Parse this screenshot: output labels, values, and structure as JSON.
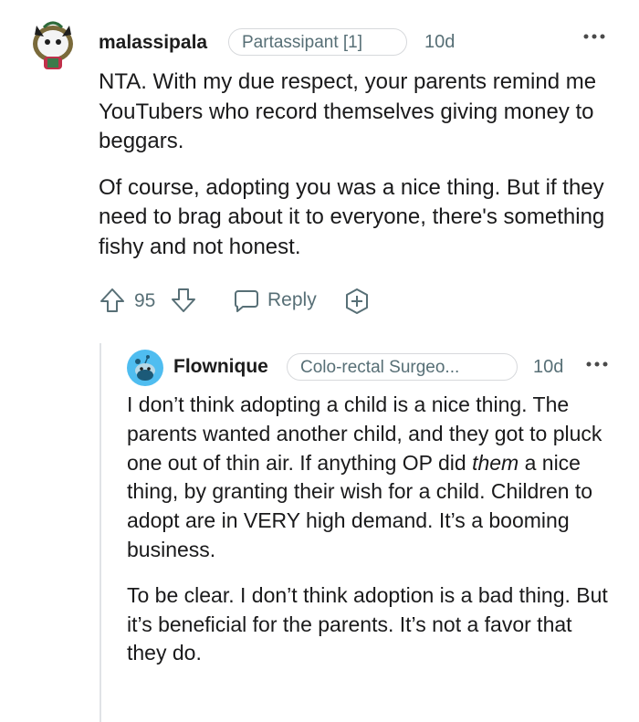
{
  "comment": {
    "username": "malassipala",
    "flair": "Partassipant [1]",
    "time": "10d",
    "paragraphs": [
      "NTA. With my due respect, your parents remind me YouTubers who record themselves giving money to beggars.",
      "Of course, adopting you was a nice thing. But if they need to brag about it to everyone, there's something fishy and not honest."
    ],
    "votes": "95",
    "reply_label": "Reply"
  },
  "reply": {
    "username": "Flownique",
    "flair": "Colo-rectal Surgeo...",
    "time": "10d",
    "p1_before": "I don’t think adopting a child is a nice thing. The parents wanted another child, and they got to pluck one out of thin air. If anything OP did ",
    "p1_emphasis": "them",
    "p1_after": " a nice thing, by granting their wish for a child. Children to adopt are in VERY high demand. It’s a booming business.",
    "p2": "To be clear. I don’t think adoption is a bad thing. But it’s beneficial for the parents. It’s not a favor that they do."
  },
  "icons": {
    "upvote": "arrow-up-icon",
    "downvote": "arrow-down-icon",
    "reply": "speech-bubble-icon",
    "award": "plus-circle-icon",
    "more": "more-options-icon"
  },
  "colors": {
    "text": "#1a1a1b",
    "meta": "#576f76",
    "flair_border": "#d7d9dc",
    "reply_avatar": "#4fbdf0"
  }
}
